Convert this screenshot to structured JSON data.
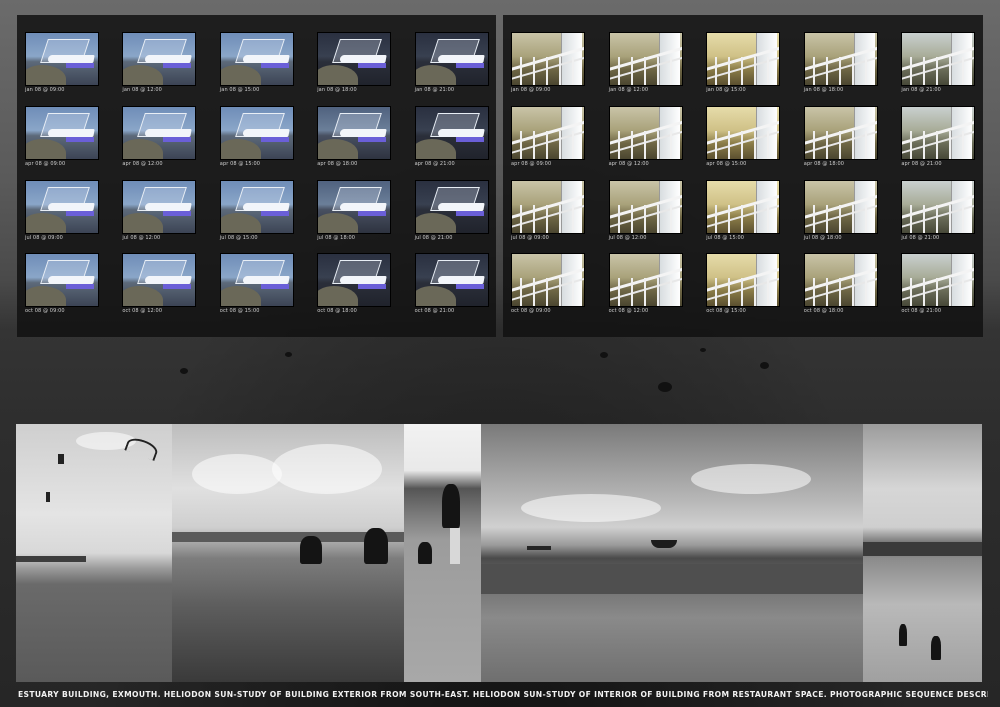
{
  "caption": "ESTUARY BUILDING, EXMOUTH.    HELIODON SUN-STUDY OF BUILDING EXTERIOR FROM SOUTH-EAST. HELIODON SUN-STUDY OF INTERIOR OF BUILDING FROM RESTAURANT SPACE. PHOTOGRAPHIC SEQUENCE DESCRIBING ESTUARY BUILDING'S SITE.",
  "exterior_study": {
    "rows": [
      [
        "jan 08 @ 09:00",
        "jan 08 @ 12:00",
        "jan 08 @ 15:00",
        "jan 08 @ 18:00",
        "jan 08 @ 21:00"
      ],
      [
        "apr 08 @ 09:00",
        "apr 08 @ 12:00",
        "apr 08 @ 15:00",
        "apr 08 @ 18:00",
        "apr 08 @ 21:00"
      ],
      [
        "jul 08 @ 09:00",
        "jul 08 @ 12:00",
        "jul 08 @ 15:00",
        "jul 08 @ 18:00",
        "jul 08 @ 21:00"
      ],
      [
        "oct 08 @ 09:00",
        "oct 08 @ 12:00",
        "oct 08 @ 15:00",
        "oct 08 @ 18:00",
        "oct 08 @ 21:00"
      ]
    ]
  },
  "interior_study": {
    "rows": [
      [
        "jan 08 @ 09:00",
        "jan 08 @ 12:00",
        "jan 08 @ 15:00",
        "jan 08 @ 18:00",
        "jan 08 @ 21:00"
      ],
      [
        "apr 08 @ 09:00",
        "apr 08 @ 12:00",
        "apr 08 @ 15:00",
        "apr 08 @ 18:00",
        "apr 08 @ 21:00"
      ],
      [
        "jul 08 @ 09:00",
        "jul 08 @ 12:00",
        "jul 08 @ 15:00",
        "jul 08 @ 18:00",
        "jul 08 @ 21:00"
      ],
      [
        "oct 08 @ 09:00",
        "oct 08 @ 12:00",
        "oct 08 @ 15:00",
        "oct 08 @ 18:00",
        "oct 08 @ 21:00"
      ]
    ]
  }
}
